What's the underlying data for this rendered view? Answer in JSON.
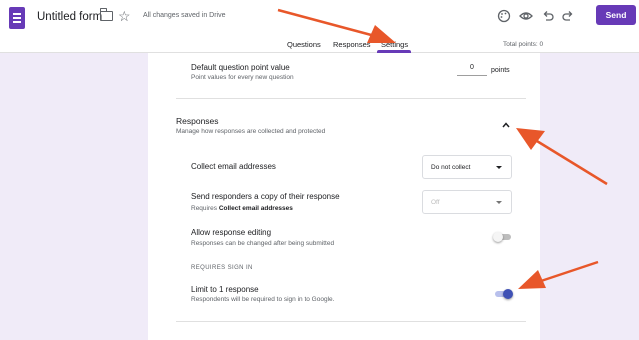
{
  "header": {
    "form_title": "Untitled form",
    "saved_status": "All changes saved in Drive",
    "send_label": "Send",
    "icons": [
      "forms-logo-icon",
      "folder-icon",
      "star-icon",
      "palette-icon",
      "eye-icon",
      "undo-icon",
      "redo-icon"
    ]
  },
  "tabs": [
    {
      "label": "Questions"
    },
    {
      "label": "Responses"
    },
    {
      "label": "Settings",
      "active": true
    }
  ],
  "total_points": "Total points: 0",
  "settings": {
    "default_points": {
      "label": "Default question point value",
      "description": "Point values for every new question",
      "value": "0",
      "unit": "points"
    },
    "responses_section": {
      "title": "Responses",
      "description": "Manage how responses are collected and protected",
      "expanded": true
    },
    "collect_email": {
      "label": "Collect email addresses",
      "selected": "Do not collect"
    },
    "send_copy": {
      "label": "Send responders a copy of their response",
      "requires_prefix": "Requires ",
      "requires_bold": "Collect email addresses",
      "selected": "Off",
      "disabled": true
    },
    "allow_editing": {
      "label": "Allow response editing",
      "description": "Responses can be changed after being submitted",
      "enabled": false
    },
    "requires_sign_in": "REQUIRES SIGN IN",
    "limit_one": {
      "label": "Limit to 1 response",
      "description": "Respondents will be required to sign in to Google.",
      "enabled": true
    }
  },
  "colors": {
    "accent": "#673ab7",
    "canvas": "#f0ebf8",
    "toggle_on": "#3f51b5",
    "annotation_arrow": "#e8572a"
  }
}
